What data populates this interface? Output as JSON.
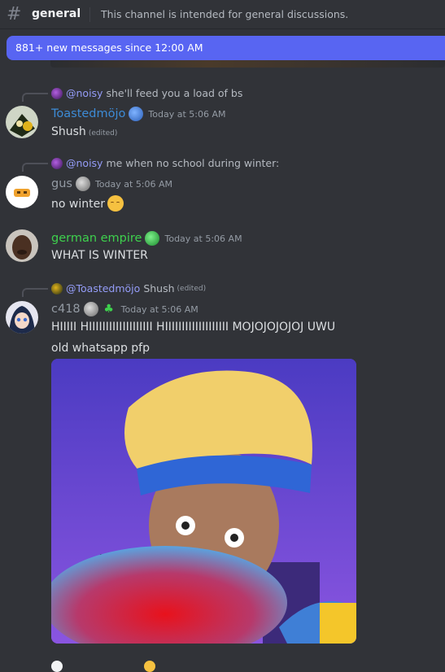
{
  "header": {
    "channel_name": "general",
    "topic": "This channel is intended for general discussions."
  },
  "new_messages_bar": {
    "label": "881+ new messages since 12:00 AM"
  },
  "messages": [
    {
      "reply": {
        "mention": "@noisy",
        "text": "she'll feed you a load of bs"
      },
      "author": "Toastedmöjo",
      "author_color": "#3d8bd6",
      "timestamp": "Today at 5:06 AM",
      "content": "Shush",
      "edited": "(edited)"
    },
    {
      "reply": {
        "mention": "@noisy",
        "text": "me when no school during winter:"
      },
      "author": "gus",
      "author_color": "#949ba4",
      "timestamp": "Today at 5:06 AM",
      "content": "no winter",
      "emoji": "pensive-face"
    },
    {
      "author": "german empire",
      "author_color": "#3ed14d",
      "timestamp": "Today at 5:06 AM",
      "content": "WHAT IS WINTER"
    },
    {
      "reply": {
        "mention": "@Toastedmöjo",
        "text": "Shush",
        "edited": "(edited)"
      },
      "author": "c418",
      "author_color": "#949ba4",
      "timestamp": "Today at 5:06 AM",
      "content": "HIIIII HIIIIIIIIIIIIIIIIIII HIIIIIIIIIIIIIIIIIII MOJOJOJOJOJ UWU",
      "content2": "old whatsapp pfp",
      "attachment": "image"
    }
  ],
  "colors": {
    "background": "#313338",
    "accent": "#5865f2",
    "mention": "#949cf7"
  }
}
